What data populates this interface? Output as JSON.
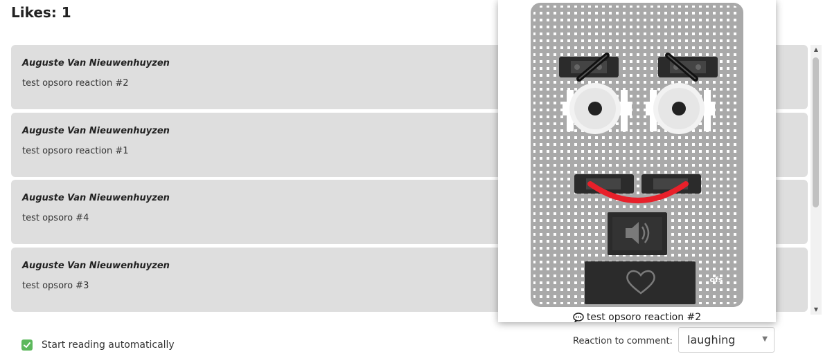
{
  "likes_label": "Likes: 1",
  "comments": [
    {
      "author": "Auguste Van Nieuwenhuyzen",
      "text": "test opsoro reaction #2"
    },
    {
      "author": "Auguste Van Nieuwenhuyzen",
      "text": "test opsoro reaction #1"
    },
    {
      "author": "Auguste Van Nieuwenhuyzen",
      "text": "test opsoro #4"
    },
    {
      "author": "Auguste Van Nieuwenhuyzen",
      "text": "test opsoro #3"
    }
  ],
  "auto_read": {
    "label": "Start reading automatically",
    "checked": true
  },
  "reaction": {
    "label": "Reaction to comment:",
    "selected": "laughing"
  },
  "popup": {
    "caption": "test opsoro reaction #2",
    "speech_icon": "speech-bubble-icon"
  },
  "colors": {
    "accent_green": "#5cb85c",
    "mouth_red": "#e8202a",
    "card_bg": "#dedede",
    "board_gray": "#a9a9a9"
  }
}
